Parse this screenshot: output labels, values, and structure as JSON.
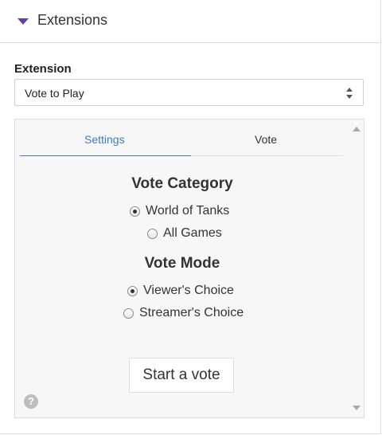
{
  "header": {
    "title": "Extensions",
    "caret_color": "#6441a5"
  },
  "extension_select": {
    "label": "Extension",
    "value": "Vote to Play"
  },
  "tabs": [
    {
      "label": "Settings",
      "active": true
    },
    {
      "label": "Vote",
      "active": false
    }
  ],
  "vote_category": {
    "title": "Vote Category",
    "options": [
      {
        "label": "World of Tanks",
        "checked": true
      },
      {
        "label": "All Games",
        "checked": false
      }
    ]
  },
  "vote_mode": {
    "title": "Vote Mode",
    "options": [
      {
        "label": "Viewer's Choice",
        "checked": true
      },
      {
        "label": "Streamer's Choice",
        "checked": false
      }
    ]
  },
  "start_button": {
    "label": "Start a vote"
  },
  "help": {
    "glyph": "?"
  },
  "colors": {
    "active_tab": "#3b7cc4",
    "border": "#dcdcdc",
    "frame_bg": "#f7f7f7"
  }
}
